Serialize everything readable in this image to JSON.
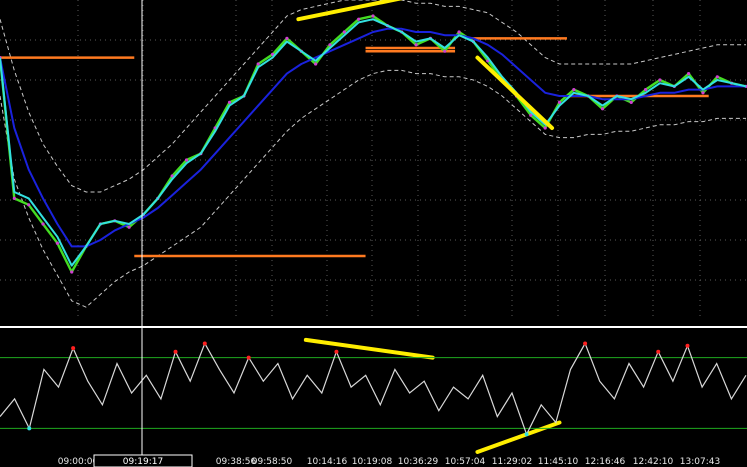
{
  "colors": {
    "background": "#000000",
    "price": "#44dd22",
    "ma_fast": "#33e0e0",
    "ma_slow": "#1a22dd",
    "band": "#c8c8c8",
    "support_resistance": "#ff7a20",
    "trendline": "#ffee00",
    "oscillator": "#d8d8d8",
    "oscillator_high": "#ff2020",
    "oscillator_low": "#30e0e0",
    "osc_threshold": "#1faa1f",
    "divider": "#ffffff",
    "cursor": "#ffffff"
  },
  "chart_data": [
    {
      "type": "line",
      "panel": "price",
      "x_axis_labels": [
        "09:00:00",
        "09:19:17",
        "09:38:56",
        "09:58:50",
        "10:14:16",
        "10:19:08",
        "10:36:29",
        "10:57:04",
        "11:29:02",
        "11:45:10",
        "12:16:46",
        "12:42:10",
        "13:07:43"
      ],
      "y_range": [
        0,
        100
      ],
      "grid": "dotted",
      "series": [
        {
          "role": "price",
          "values": [
            82,
            38,
            36,
            30,
            24,
            15,
            23,
            30,
            31,
            29,
            33,
            38,
            45,
            50,
            52,
            60,
            68,
            70,
            80,
            83,
            88,
            84,
            80,
            86,
            90,
            94,
            95,
            92,
            90,
            86,
            88,
            84,
            90,
            87,
            81,
            75,
            70,
            64,
            60,
            68,
            72,
            70,
            66,
            70,
            68,
            72,
            75,
            73,
            77,
            71,
            76,
            74,
            73
          ]
        },
        {
          "role": "ma_fast",
          "values": [
            82,
            40,
            38,
            32,
            26,
            17,
            23,
            30,
            31,
            30,
            33,
            38,
            44,
            49,
            52,
            59,
            67,
            70,
            79,
            82,
            87,
            84,
            81,
            85,
            89,
            93,
            94,
            92,
            90,
            87,
            88,
            85,
            89,
            87,
            82,
            76,
            71,
            65,
            61,
            67,
            71,
            70,
            67,
            70,
            69,
            71,
            74,
            73,
            76,
            72,
            75,
            74,
            73
          ]
        },
        {
          "role": "ma_slow",
          "values": [
            82,
            60,
            47,
            38,
            30,
            23,
            23,
            25,
            28,
            30,
            32,
            35,
            39,
            43,
            47,
            52,
            57,
            62,
            67,
            72,
            77,
            80,
            82,
            84,
            86,
            88,
            90,
            91,
            91,
            90,
            90,
            89,
            89,
            88,
            86,
            83,
            79,
            75,
            71,
            70,
            70,
            70,
            69,
            69,
            69,
            70,
            71,
            71,
            72,
            72,
            73,
            73,
            73
          ]
        },
        {
          "role": "upper_band",
          "values": [
            94,
            78,
            65,
            55,
            48,
            42,
            40,
            40,
            42,
            44,
            47,
            51,
            55,
            60,
            65,
            70,
            75,
            80,
            85,
            90,
            95,
            97,
            98,
            99,
            100,
            100,
            100,
            100,
            100,
            99,
            99,
            98,
            98,
            97,
            96,
            93,
            90,
            86,
            82,
            80,
            80,
            80,
            80,
            80,
            80,
            81,
            82,
            83,
            84,
            85,
            86,
            86,
            86
          ]
        },
        {
          "role": "lower_band",
          "values": [
            70,
            44,
            32,
            22,
            14,
            6,
            4,
            8,
            12,
            15,
            17,
            20,
            23,
            26,
            29,
            34,
            39,
            44,
            49,
            54,
            59,
            63,
            66,
            69,
            72,
            75,
            77,
            78,
            78,
            77,
            77,
            76,
            76,
            75,
            73,
            70,
            66,
            62,
            58,
            57,
            57,
            58,
            58,
            59,
            59,
            60,
            61,
            61,
            62,
            62,
            63,
            63,
            63
          ]
        }
      ],
      "levels": [
        {
          "y": 82,
          "x0": 0.0,
          "x1": 0.18
        },
        {
          "y": 20,
          "x0": 0.18,
          "x1": 0.49
        },
        {
          "y": 85,
          "x0": 0.49,
          "x1": 0.61
        },
        {
          "y": 84,
          "x0": 0.49,
          "x1": 0.61
        },
        {
          "y": 88,
          "x0": 0.63,
          "x1": 0.76
        },
        {
          "y": 70,
          "x0": 0.76,
          "x1": 0.95
        }
      ],
      "trendlines": [
        {
          "x0": 0.4,
          "y0": 94,
          "x1": 0.59,
          "y1": 103
        },
        {
          "x0": 0.64,
          "y0": 82,
          "x1": 0.74,
          "y1": 60
        }
      ],
      "cursor_x": "09:19:17"
    },
    {
      "type": "line",
      "panel": "oscillator",
      "y_range": [
        0,
        100
      ],
      "thresholds": [
        80,
        20
      ],
      "series": [
        {
          "role": "oscillator",
          "values": [
            30,
            45,
            20,
            70,
            55,
            88,
            60,
            40,
            75,
            50,
            65,
            45,
            85,
            60,
            92,
            70,
            50,
            80,
            60,
            75,
            45,
            65,
            50,
            85,
            55,
            65,
            40,
            70,
            50,
            60,
            35,
            55,
            45,
            65,
            30,
            50,
            15,
            40,
            25,
            70,
            92,
            60,
            45,
            75,
            55,
            85,
            60,
            90,
            55,
            75,
            45,
            65
          ]
        }
      ],
      "trendlines": [
        {
          "x0": 0.41,
          "y0": 95,
          "x1": 0.58,
          "y1": 80
        },
        {
          "x0": 0.64,
          "y0": 0,
          "x1": 0.75,
          "y1": 25
        }
      ]
    }
  ]
}
